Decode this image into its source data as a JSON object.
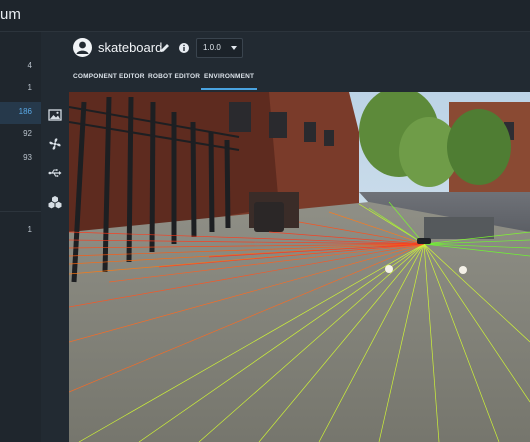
{
  "app": {
    "title": "um"
  },
  "sidebar": {
    "items": [
      {
        "count": "4",
        "active": false
      },
      {
        "count": "1",
        "active": false
      },
      {
        "count": "186",
        "active": true
      },
      {
        "count": "92",
        "active": false
      },
      {
        "count": "93",
        "active": false
      },
      {
        "count": "1",
        "active": false
      }
    ]
  },
  "robot": {
    "name": "skateboard",
    "version": "1.0.0"
  },
  "tabs": [
    {
      "label": "COMPONENT EDITOR",
      "active": false
    },
    {
      "label": "ROBOT EDITOR",
      "active": false
    },
    {
      "label": "ENVIRONMENT",
      "active": true
    }
  ],
  "toolbar": {
    "tools": [
      {
        "icon": "image-icon"
      },
      {
        "icon": "fan-icon"
      },
      {
        "icon": "usb-icon"
      },
      {
        "icon": "cubes-icon"
      }
    ]
  },
  "colors": {
    "accent": "#4aa3e0",
    "ray_near": "#ff3a1a",
    "ray_far": "#7dff2a"
  }
}
